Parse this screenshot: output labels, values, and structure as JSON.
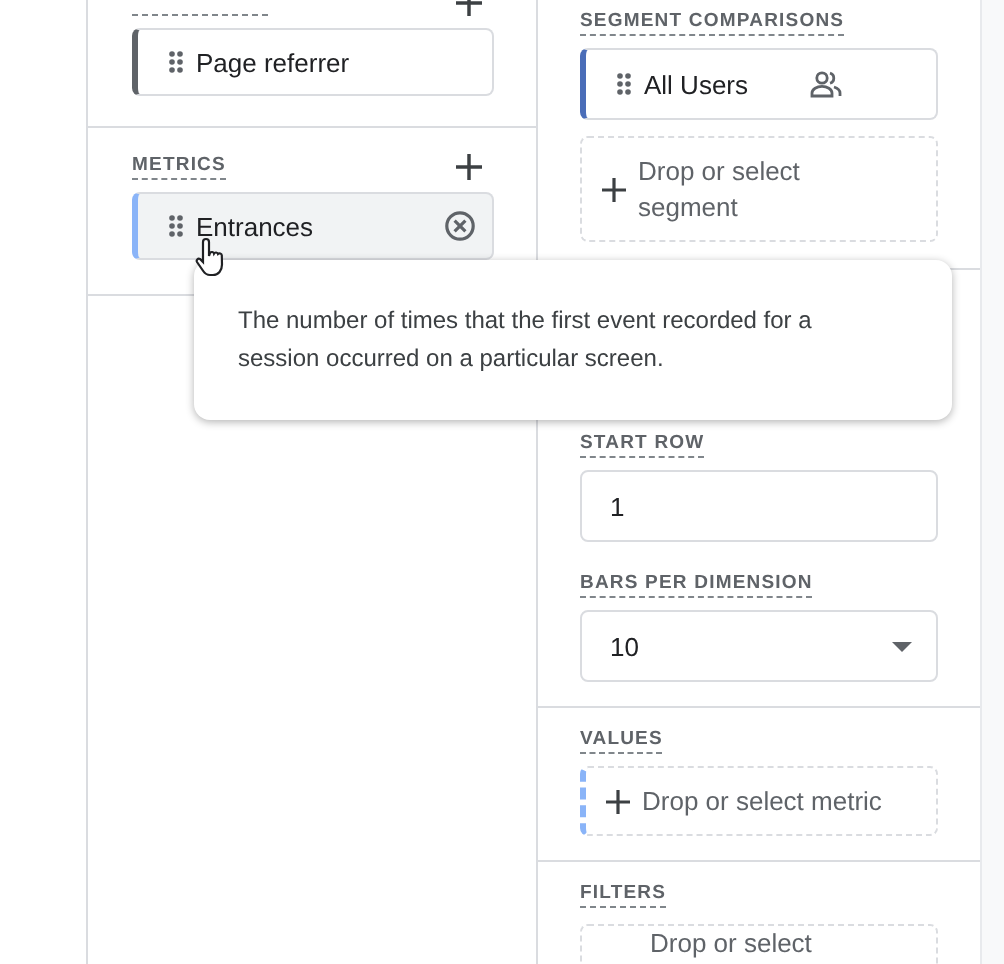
{
  "dimensions": {
    "items": [
      {
        "label": "Page referrer",
        "hovered": false
      }
    ]
  },
  "metrics": {
    "title": "METRICS",
    "items": [
      {
        "label": "Entrances",
        "hovered": true
      }
    ]
  },
  "tooltip": {
    "text": "The number of times that the first event recorded for a session occurred on a particular screen."
  },
  "segment_comparisons": {
    "title": "SEGMENT COMPARISONS",
    "items": [
      {
        "label": "All Users"
      }
    ],
    "drop": "Drop or select segment"
  },
  "start_row": {
    "label": "START ROW",
    "value": "1"
  },
  "bars_per_dimension": {
    "label": "BARS PER DIMENSION",
    "value": "10"
  },
  "values": {
    "title": "VALUES",
    "drop": "Drop or select metric"
  },
  "filters": {
    "title": "FILTERS",
    "drop": "Drop or select"
  }
}
